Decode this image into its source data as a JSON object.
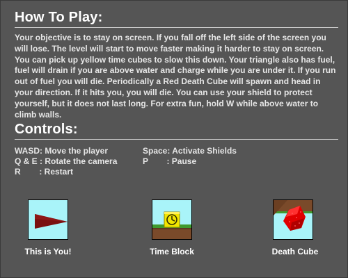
{
  "how_to_play": {
    "title": "How To Play:",
    "body": "Your objective is to stay on screen. If you fall off the left side of the screen you will lose. The level will start to move faster making it harder to stay on screen. You can pick up yellow time cubes to slow this down. Your triangle also has fuel, fuel will drain if you are above water and charge while you are under it. If you run out of fuel you will die. Periodically a Red Death Cube will spawn and head in your direction. If it hits you, you will die. You can use your shield to protect yourself, but it does not last long. For extra fun, hold W while above water to climb walls."
  },
  "controls": {
    "title": "Controls:",
    "left": [
      "WASD: Move the player",
      "Q & E : Rotate the camera",
      "R        : Restart"
    ],
    "right": [
      "Space: Activate Shields",
      "P        : Pause"
    ]
  },
  "legend": [
    {
      "label": "This is You!",
      "icon": "player-triangle-icon"
    },
    {
      "label": "Time Block",
      "icon": "time-block-icon"
    },
    {
      "label": "Death Cube",
      "icon": "death-cube-icon"
    }
  ],
  "colors": {
    "background": "#555555",
    "sky": "#a9f4f9",
    "player": "#7a1010",
    "time_block": "#f2e600",
    "grass": "#3f9a2e",
    "dirt": "#7a4a2a",
    "death_cube": "#e00000"
  }
}
